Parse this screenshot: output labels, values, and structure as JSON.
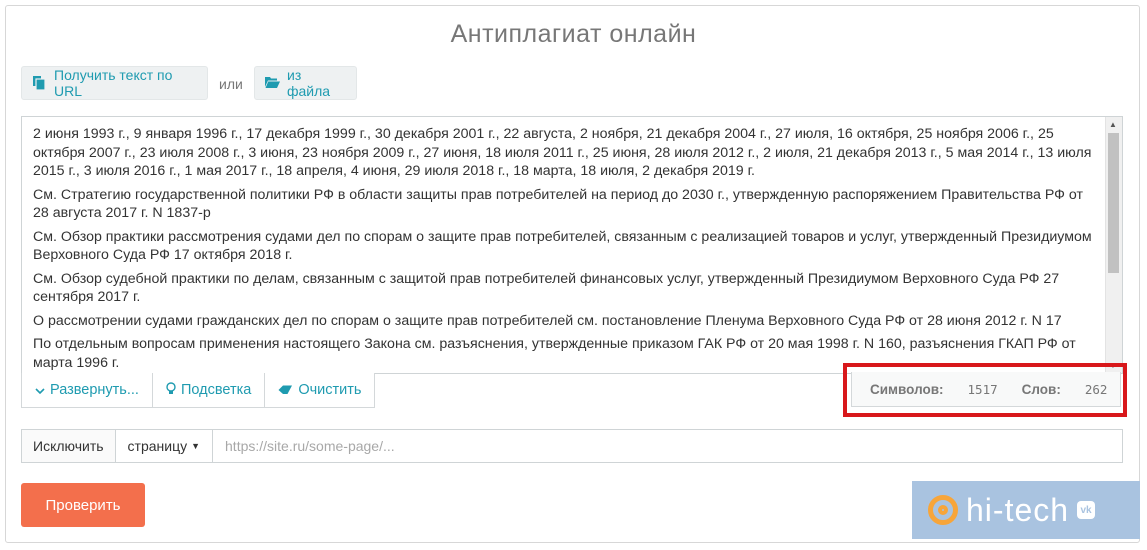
{
  "page": {
    "title": "Антиплагиат онлайн"
  },
  "source_buttons": {
    "url_label": "Получить текст по URL",
    "or_text": "или",
    "file_label": "из файла"
  },
  "text_area": {
    "paragraphs": [
      "2 июня 1993 г., 9 января 1996 г., 17 декабря 1999 г., 30 декабря 2001 г., 22 августа, 2 ноября, 21 декабря 2004 г., 27 июля, 16 октября, 25 ноября 2006 г., 25 октября 2007 г., 23 июля 2008 г., 3 июня, 23 ноября 2009 г., 27 июня, 18 июля 2011 г., 25 июня, 28 июля 2012 г., 2 июля, 21 декабря 2013 г., 5 мая 2014 г., 13 июля 2015 г., 3 июля 2016 г., 1 мая 2017 г., 18 апреля, 4 июня, 29 июля 2018 г., 18 марта, 18 июля, 2 декабря 2019 г.",
      "См. Стратегию государственной политики РФ в области защиты прав потребителей на период до 2030 г., утвержденную распоряжением Правительства РФ от 28 августа 2017 г. N 1837-р",
      "См. Обзор практики рассмотрения судами дел по спорам о защите прав потребителей, связанным с реализацией товаров и услуг, утвержденный Президиумом Верховного Суда РФ 17 октября 2018 г.",
      "См. Обзор судебной практики по делам, связанным с защитой прав потребителей финансовых услуг, утвержденный Президиумом Верховного Суда РФ 27 сентября 2017 г.",
      "О рассмотрении судами гражданских дел по спорам о защите прав потребителей см. постановление Пленума Верховного Суда РФ от 28 июня 2012 г. N 17",
      "По отдельным вопросам применения настоящего Закона см. разъяснения, утвержденные приказом ГАК РФ от 20 мая 1998 г. N 160, разъяснения ГКАП РФ от марта 1996 г."
    ]
  },
  "tools": {
    "expand_label": "Развернуть...",
    "highlight_label": "Подсветка",
    "clear_label": "Очистить"
  },
  "counter": {
    "chars_label": "Символов:",
    "chars_value": "1517",
    "words_label": "Слов:",
    "words_value": "262"
  },
  "exclude": {
    "label": "Исключить",
    "dropdown_value": "страницу",
    "placeholder": "https://site.ru/some-page/..."
  },
  "check_button": {
    "label": "Проверить"
  },
  "watermark": {
    "text": "hi-tech",
    "vk": "vk"
  },
  "colors": {
    "accent": "#1f9bb0",
    "primary_button": "#f36f4c",
    "highlight_frame": "#d8181b"
  }
}
